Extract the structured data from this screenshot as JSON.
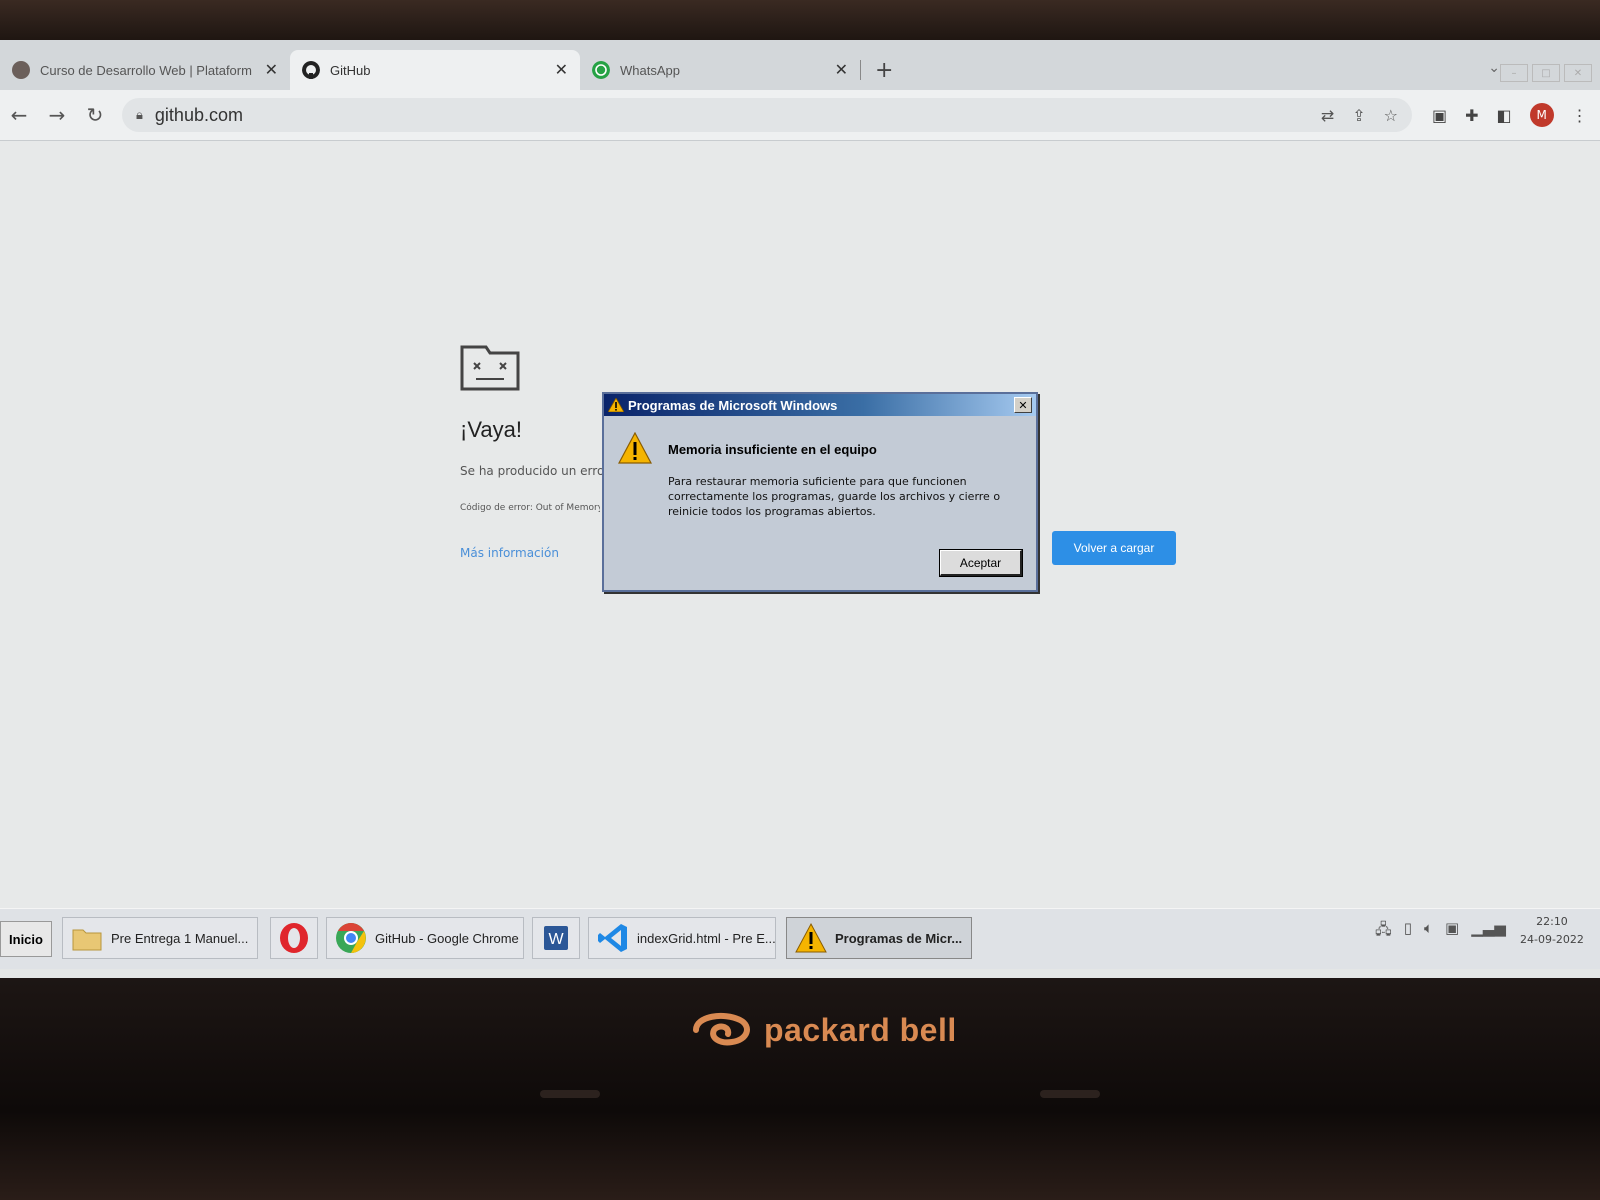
{
  "browser": {
    "tabs": [
      {
        "label": "Curso de Desarrollo Web | Plataform",
        "icon": "coderhouse-icon"
      },
      {
        "label": "GitHub",
        "icon": "github-icon",
        "active": true
      },
      {
        "label": "WhatsApp",
        "icon": "whatsapp-icon"
      }
    ],
    "new_tab_symbol": "+",
    "close_symbol": "✕",
    "address": "github.com"
  },
  "error_page": {
    "title": "¡Vaya!",
    "text": "Se ha producido un error",
    "code": "Código de error: Out of Memory",
    "more_link": "Más información",
    "reload_button": "Volver a cargar"
  },
  "dialog": {
    "title": "Programas de Microsoft Windows",
    "heading": "Memoria insuficiente en el equipo",
    "message": "Para restaurar memoria suficiente para que funcionen correctamente los programas, guarde los archivos y cierre o reinicie todos los programas abiertos.",
    "ok_button": "Aceptar",
    "close_symbol": "✕"
  },
  "taskbar": {
    "start_label": "Inicio",
    "items": [
      {
        "label": "Pre Entrega 1 Manuel...",
        "icon": "folder-icon"
      },
      {
        "label": "",
        "icon": "opera-icon"
      },
      {
        "label": "GitHub - Google Chrome",
        "icon": "chrome-icon"
      },
      {
        "label": "",
        "icon": "word-icon"
      },
      {
        "label": "indexGrid.html - Pre E...",
        "icon": "vscode-icon"
      },
      {
        "label": "Programas de Micr...",
        "icon": "warning-icon",
        "active": true
      }
    ],
    "clock_time": "22:10",
    "clock_date": "24-09-2022"
  },
  "hardware": {
    "brand": "packard bell"
  },
  "colors": {
    "reload_button": "#2d8fe6",
    "dialog_title_start": "#0a246a",
    "link": "#4a8fd8"
  }
}
